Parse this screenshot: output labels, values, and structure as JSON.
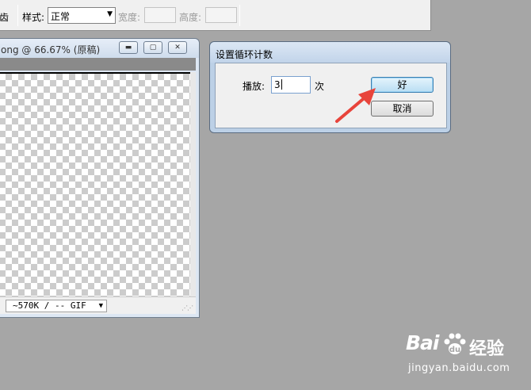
{
  "toolbar": {
    "antialias_label": "消除锯齿",
    "antialias_visible": "齿",
    "style_label": "样式:",
    "style_value": "正常",
    "width_label": "宽度:",
    "height_label": "高度:"
  },
  "document_window": {
    "title": "ong @ 66.67% (原稿)",
    "minimize_glyph": "▬",
    "maximize_glyph": "▢",
    "close_glyph": "✕",
    "status_value": "~570K / -- GIF",
    "status_arrow": "▼"
  },
  "dialog": {
    "title": "设置循环计数",
    "play_label": "播放:",
    "play_count": "3",
    "times_label": "次",
    "ok_label": "好",
    "cancel_label": "取消"
  },
  "annotation": {
    "color": "#e8443b"
  },
  "watermark": {
    "logo_text": "Bai",
    "logo_suffix": "经验",
    "url": "jingyan.baidu.com"
  }
}
